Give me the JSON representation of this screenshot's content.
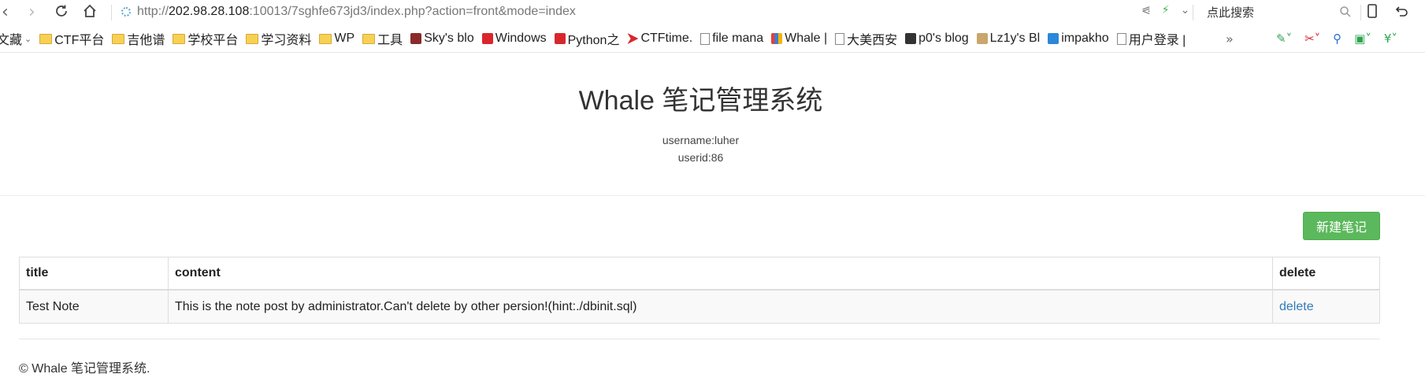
{
  "browser": {
    "url_prefix": "http://",
    "url_host": "202.98.28.108",
    "url_rest": ":10013/7sghfe673jd3/index.php?action=front&mode=index",
    "search_placeholder": "点此搜索"
  },
  "bookmarks": [
    {
      "label": "文藏",
      "icon": "chevron-down",
      "type": "text"
    },
    {
      "label": "CTF平台",
      "type": "folder"
    },
    {
      "label": "吉他谱",
      "type": "folder"
    },
    {
      "label": "学校平台",
      "type": "folder"
    },
    {
      "label": "学习资料",
      "type": "folder"
    },
    {
      "label": "WP",
      "type": "folder"
    },
    {
      "label": "工具",
      "type": "folder"
    },
    {
      "label": "Sky's blo",
      "type": "site",
      "color": "#8a2b2b"
    },
    {
      "label": "Windows",
      "type": "site",
      "color": "#d9262c"
    },
    {
      "label": "Python之",
      "type": "site",
      "color": "#d9262c"
    },
    {
      "label": "CTFtime.",
      "type": "site",
      "color": "#d9262c"
    },
    {
      "label": "file mana",
      "type": "page"
    },
    {
      "label": "Whale |",
      "type": "site",
      "color": "#3b7dd8"
    },
    {
      "label": "大美西安",
      "type": "page"
    },
    {
      "label": "p0's blog",
      "type": "site",
      "color": "#333333"
    },
    {
      "label": "Lz1y's Bl",
      "type": "site",
      "color": "#c9a66b"
    },
    {
      "label": "impakho",
      "type": "site",
      "color": "#2b88d8"
    },
    {
      "label": "用户登录 |",
      "type": "page"
    }
  ],
  "bookmarks_more": "»",
  "page": {
    "title": "Whale 笔记管理系统",
    "username": "username:luher",
    "userid": "userid:86",
    "new_button": "新建笔记",
    "table": {
      "headers": [
        "title",
        "content",
        "delete"
      ],
      "rows": [
        [
          "Test Note",
          "This is the note post by administrator.Can't delete by other persion!(hint:./dbinit.sql)",
          "delete"
        ]
      ]
    },
    "footer": "© Whale 笔记管理系统."
  },
  "colors": {
    "accent_green": "#5cb85c",
    "link_blue": "#337ab7"
  }
}
